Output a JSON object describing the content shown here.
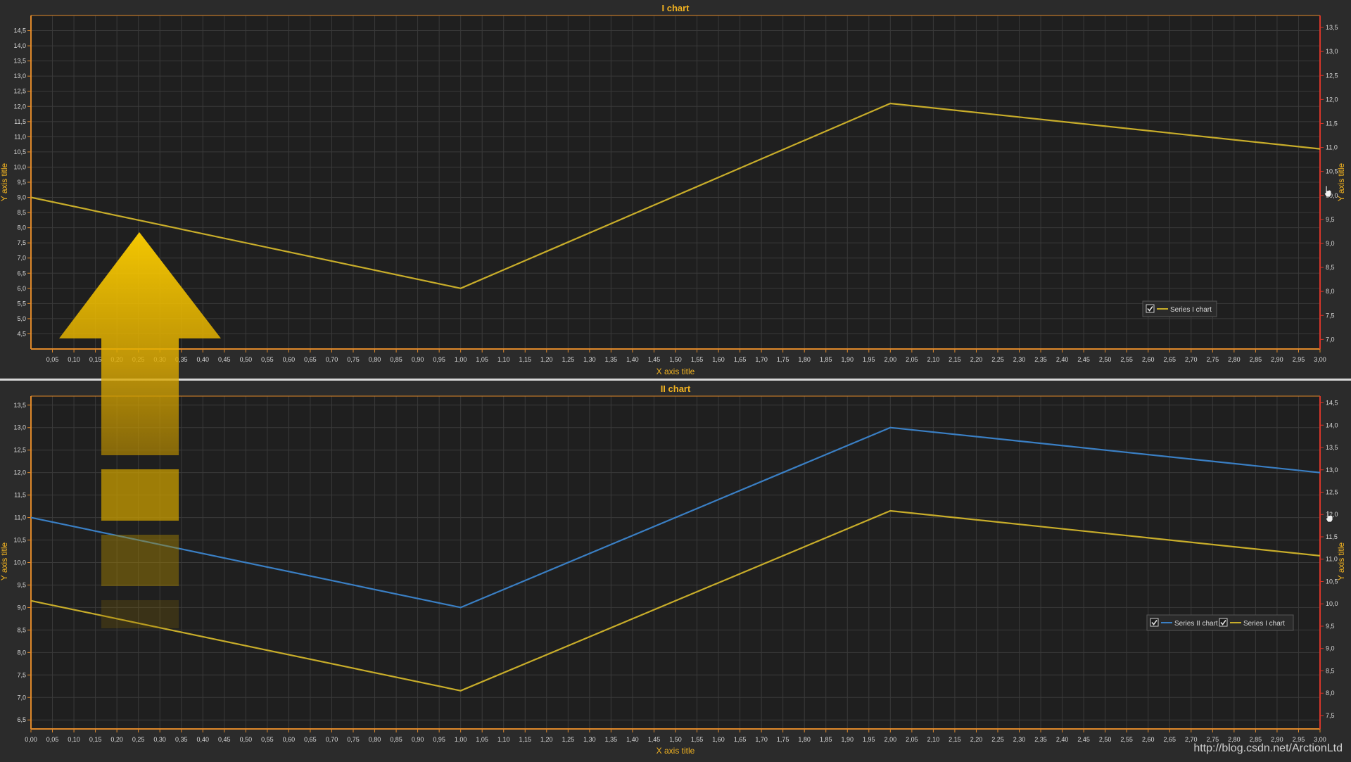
{
  "chart_data": [
    {
      "type": "line",
      "title": "I chart",
      "xlabel": "X axis title",
      "ylabel": "Y axis title",
      "y2label": "Y axis title",
      "xlim": [
        0.0,
        3.0
      ],
      "ylim": [
        4.0,
        15.0
      ],
      "y2lim": [
        6.8,
        13.75
      ],
      "grid": true,
      "legend": "bottom-right",
      "xticks": [
        "0,05",
        "0,10",
        "0,15",
        "0,20",
        "0,25",
        "0,30",
        "0,35",
        "0,40",
        "0,45",
        "0,50",
        "0,55",
        "0,60",
        "0,65",
        "0,70",
        "0,75",
        "0,80",
        "0,85",
        "0,90",
        "0,95",
        "1,00",
        "1,05",
        "1,10",
        "1,15",
        "1,20",
        "1,25",
        "1,30",
        "1,35",
        "1,40",
        "1,45",
        "1,50",
        "1,55",
        "1,60",
        "1,65",
        "1,70",
        "1,75",
        "1,80",
        "1,85",
        "1,90",
        "1,95",
        "2,00",
        "2,05",
        "2,10",
        "2,15",
        "2,20",
        "2,25",
        "2,30",
        "2,35",
        "2,40",
        "2,45",
        "2,50",
        "2,55",
        "2,60",
        "2,65",
        "2,70",
        "2,75",
        "2,80",
        "2,85",
        "2,90",
        "2,95",
        "3,00"
      ],
      "yticks": [
        "4,5",
        "5,0",
        "5,5",
        "6,0",
        "6,5",
        "7,0",
        "7,5",
        "8,0",
        "8,5",
        "9,0",
        "9,5",
        "10,0",
        "10,5",
        "11,0",
        "11,5",
        "12,0",
        "12,5",
        "13,0",
        "13,5",
        "14,0",
        "14,5"
      ],
      "y2ticks": [
        "7,0",
        "7,5",
        "8,0",
        "8,5",
        "9,0",
        "9,5",
        "10,0",
        "10,5",
        "11,0",
        "11,5",
        "12,0",
        "12,5",
        "13,0",
        "13,5"
      ],
      "series": [
        {
          "name": "Series I chart",
          "color": "#c8ad2a",
          "x": [
            0,
            1,
            2,
            3
          ],
          "y": [
            9.0,
            6.0,
            12.1,
            10.6
          ]
        }
      ]
    },
    {
      "type": "line",
      "title": "II chart",
      "xlabel": "X axis title",
      "ylabel": "Y axis title",
      "y2label": "Y axis title",
      "xlim": [
        0.0,
        3.0
      ],
      "ylim": [
        6.3,
        13.7
      ],
      "y2lim": [
        7.2,
        14.65
      ],
      "grid": true,
      "legend": "bottom-right",
      "xticks": [
        "0,00",
        "0,05",
        "0,10",
        "0,15",
        "0,20",
        "0,25",
        "0,30",
        "0,35",
        "0,40",
        "0,45",
        "0,50",
        "0,55",
        "0,60",
        "0,65",
        "0,70",
        "0,75",
        "0,80",
        "0,85",
        "0,90",
        "0,95",
        "1,00",
        "1,05",
        "1,10",
        "1,15",
        "1,20",
        "1,25",
        "1,30",
        "1,35",
        "1,40",
        "1,45",
        "1,50",
        "1,55",
        "1,60",
        "1,65",
        "1,70",
        "1,75",
        "1,80",
        "1,85",
        "1,90",
        "1,95",
        "2,00",
        "2,05",
        "2,10",
        "2,15",
        "2,20",
        "2,25",
        "2,30",
        "2,35",
        "2,40",
        "2,45",
        "2,50",
        "2,55",
        "2,60",
        "2,65",
        "2,70",
        "2,75",
        "2,80",
        "2,85",
        "2,90",
        "2,95",
        "3,00"
      ],
      "yticks": [
        "6,5",
        "7,0",
        "7,5",
        "8,0",
        "8,5",
        "9,0",
        "9,5",
        "10,0",
        "10,5",
        "11,0",
        "11,5",
        "12,0",
        "12,5",
        "13,0",
        "13,5"
      ],
      "y2ticks": [
        "7,5",
        "8,0",
        "8,5",
        "9,0",
        "9,5",
        "10,0",
        "10,5",
        "11,0",
        "11,5",
        "12,0",
        "12,5",
        "13,0",
        "13,5",
        "14,0",
        "14,5"
      ],
      "series": [
        {
          "name": "Series II chart",
          "color": "#3a7fc4",
          "x": [
            0,
            1,
            2,
            3
          ],
          "y": [
            11.0,
            9.0,
            13.0,
            12.0
          ]
        },
        {
          "name": "Series I chart",
          "color": "#c8ad2a",
          "x": [
            0,
            1,
            2,
            3
          ],
          "y": [
            9.15,
            7.15,
            11.15,
            10.15
          ]
        }
      ]
    }
  ],
  "watermark": "http://blog.csdn.net/ArctionLtd",
  "colors": {
    "background": "#2b2b2b",
    "plot_bg": "#1f1f1f",
    "grid": "#3a3a3a",
    "axis": "#e0892a",
    "right_axis": "#d9362a",
    "title": "#f2b321",
    "tick_text": "#d8d8d8",
    "divider": "#d8d8d8",
    "arrow": "#f6c400"
  },
  "icons": {
    "legend_checkbox": "checkbox-checked-icon",
    "cursor": "hand-cursor-icon",
    "overlay": "up-arrow-icon"
  }
}
